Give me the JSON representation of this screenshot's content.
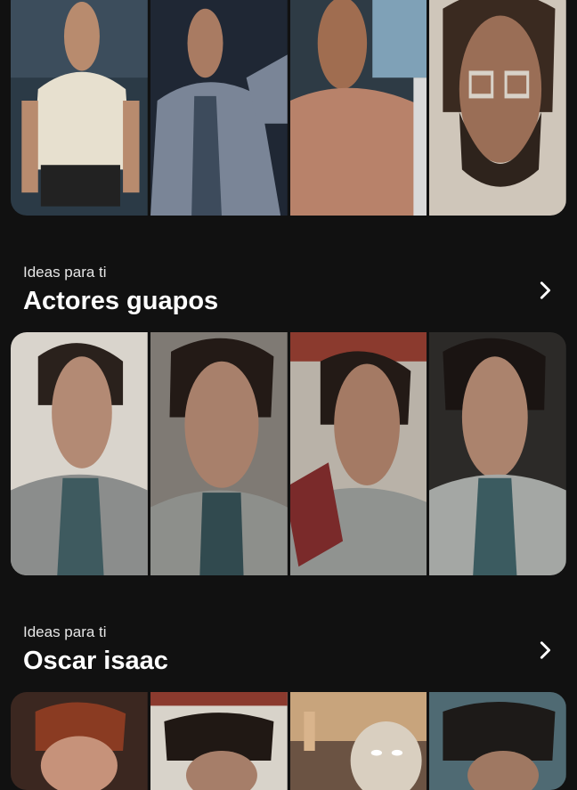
{
  "sections": [
    {
      "kicker": "Ideas para ti",
      "title": "Actores guapos",
      "chevron_icon": "chevron-right-icon"
    },
    {
      "kicker": "Ideas para ti",
      "title": "Oscar isaac",
      "chevron_icon": "chevron-right-icon"
    }
  ],
  "colors": {
    "background": "#111111",
    "text": "#ffffff"
  }
}
